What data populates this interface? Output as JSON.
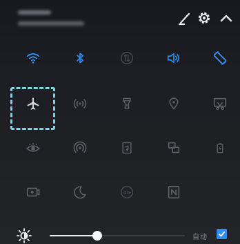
{
  "header": {
    "carrier_text": "",
    "status_text": "",
    "icons": [
      "edit-icon",
      "settings-gear-icon",
      "collapse-chevron-up-icon"
    ]
  },
  "tiles": [
    {
      "name": "wifi",
      "icon": "wifi-icon",
      "state": "on"
    },
    {
      "name": "bluetooth",
      "icon": "bluetooth-icon",
      "state": "on"
    },
    {
      "name": "mobile-data",
      "icon": "mobile-data-icon",
      "state": "off"
    },
    {
      "name": "sound",
      "icon": "speaker-icon",
      "state": "on"
    },
    {
      "name": "auto-rotate",
      "icon": "auto-rotate-icon",
      "state": "on"
    },
    {
      "name": "airplane-mode",
      "icon": "airplane-icon",
      "state": "selected"
    },
    {
      "name": "hotspot",
      "icon": "hotspot-icon",
      "state": "off"
    },
    {
      "name": "flashlight",
      "icon": "flashlight-icon",
      "state": "off"
    },
    {
      "name": "location",
      "icon": "location-pin-icon",
      "state": "off"
    },
    {
      "name": "screenshot",
      "icon": "screenshot-icon",
      "state": "off"
    },
    {
      "name": "eye-comfort",
      "icon": "eye-icon",
      "state": "off"
    },
    {
      "name": "nfc-wireless",
      "icon": "wireless-broadcast-icon",
      "state": "off"
    },
    {
      "name": "screen-share",
      "icon": "screen-share-icon",
      "state": "off"
    },
    {
      "name": "multi-screen",
      "icon": "multi-screen-icon",
      "state": "off"
    },
    {
      "name": "battery-saver",
      "icon": "battery-icon",
      "state": "off"
    },
    {
      "name": "screen-record",
      "icon": "screen-record-icon",
      "state": "off"
    },
    {
      "name": "do-not-disturb",
      "icon": "moon-icon",
      "state": "off"
    },
    {
      "name": "4g",
      "icon": "4g-icon",
      "state": "dim"
    },
    {
      "name": "nfc",
      "icon": "nfc-icon",
      "state": "off"
    }
  ],
  "brightness": {
    "level": 0.35,
    "auto_label": "自动",
    "auto_enabled": true
  },
  "colors": {
    "accent": "#2f8df2",
    "selection": "#7bd4e2",
    "panel": "#1c1e23",
    "icon_off": "#5d6068"
  }
}
